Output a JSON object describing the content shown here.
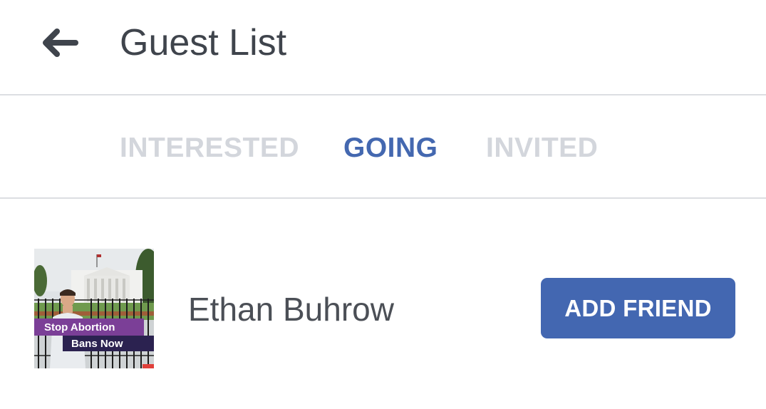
{
  "header": {
    "title": "Guest List",
    "back_icon": "arrow-left-icon"
  },
  "tabs": [
    {
      "label": "INTERESTED",
      "active": false
    },
    {
      "label": "GOING",
      "active": true
    },
    {
      "label": "INVITED",
      "active": false
    }
  ],
  "guests": [
    {
      "name": "Ethan Buhrow",
      "action_label": "ADD FRIEND",
      "avatar": {
        "banner_line1": "Stop Abortion",
        "banner_line2": "Bans Now"
      }
    }
  ],
  "colors": {
    "accent": "#4367b1",
    "tab_inactive": "#d3d6dc",
    "divider": "#dcdee2",
    "title_text": "#3f444c"
  }
}
